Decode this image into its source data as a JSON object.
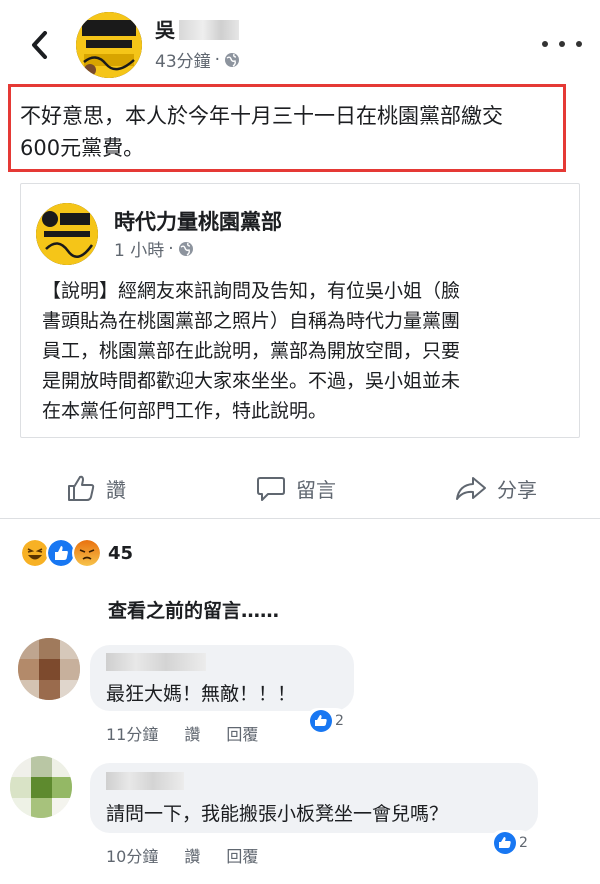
{
  "header": {
    "back_icon": "chevron-left-icon",
    "author_name": "吳",
    "time": "43分鐘",
    "separator": "·",
    "privacy_icon": "globe-icon",
    "more_icon": "more-horizontal-icon"
  },
  "post": {
    "text_line1": "不好意思，本人於今年十月三十一日在桃園黨部繳交",
    "text_line2": "600元黨費。",
    "highlight_color": "#e53935"
  },
  "shared": {
    "page_name": "時代力量桃園黨部",
    "time": "1 小時",
    "separator": "·",
    "lines": [
      "【說明】經網友來訊詢問及告知，有位吳小姐（臉",
      "書頭貼為在桃園黨部之照片）自稱為時代力量黨團",
      "員工，桃園黨部在此說明，黨部為開放空間，只要",
      "是開放時間都歡迎大家來坐坐。不過，吳小姐並未",
      "在本黨任何部門工作，特此說明。"
    ]
  },
  "actions": {
    "like": "讚",
    "comment": "留言",
    "share": "分享"
  },
  "reactions": {
    "icons": [
      "haha-icon",
      "like-icon",
      "angry-icon"
    ],
    "count": "45"
  },
  "view_previous": "查看之前的留言……",
  "comments": [
    {
      "text": "最狂大媽！無敵！！！",
      "time": "11分鐘",
      "like": "讚",
      "reply": "回覆",
      "likes": "2"
    },
    {
      "text": "請問一下，我能搬張小板凳坐一會兒嗎？",
      "time": "10分鐘",
      "like": "讚",
      "reply": "回覆",
      "likes": "2"
    }
  ],
  "colors": {
    "facebook_blue": "#1877f2",
    "meta_gray": "#606770",
    "bubble_bg": "#f0f2f5"
  }
}
